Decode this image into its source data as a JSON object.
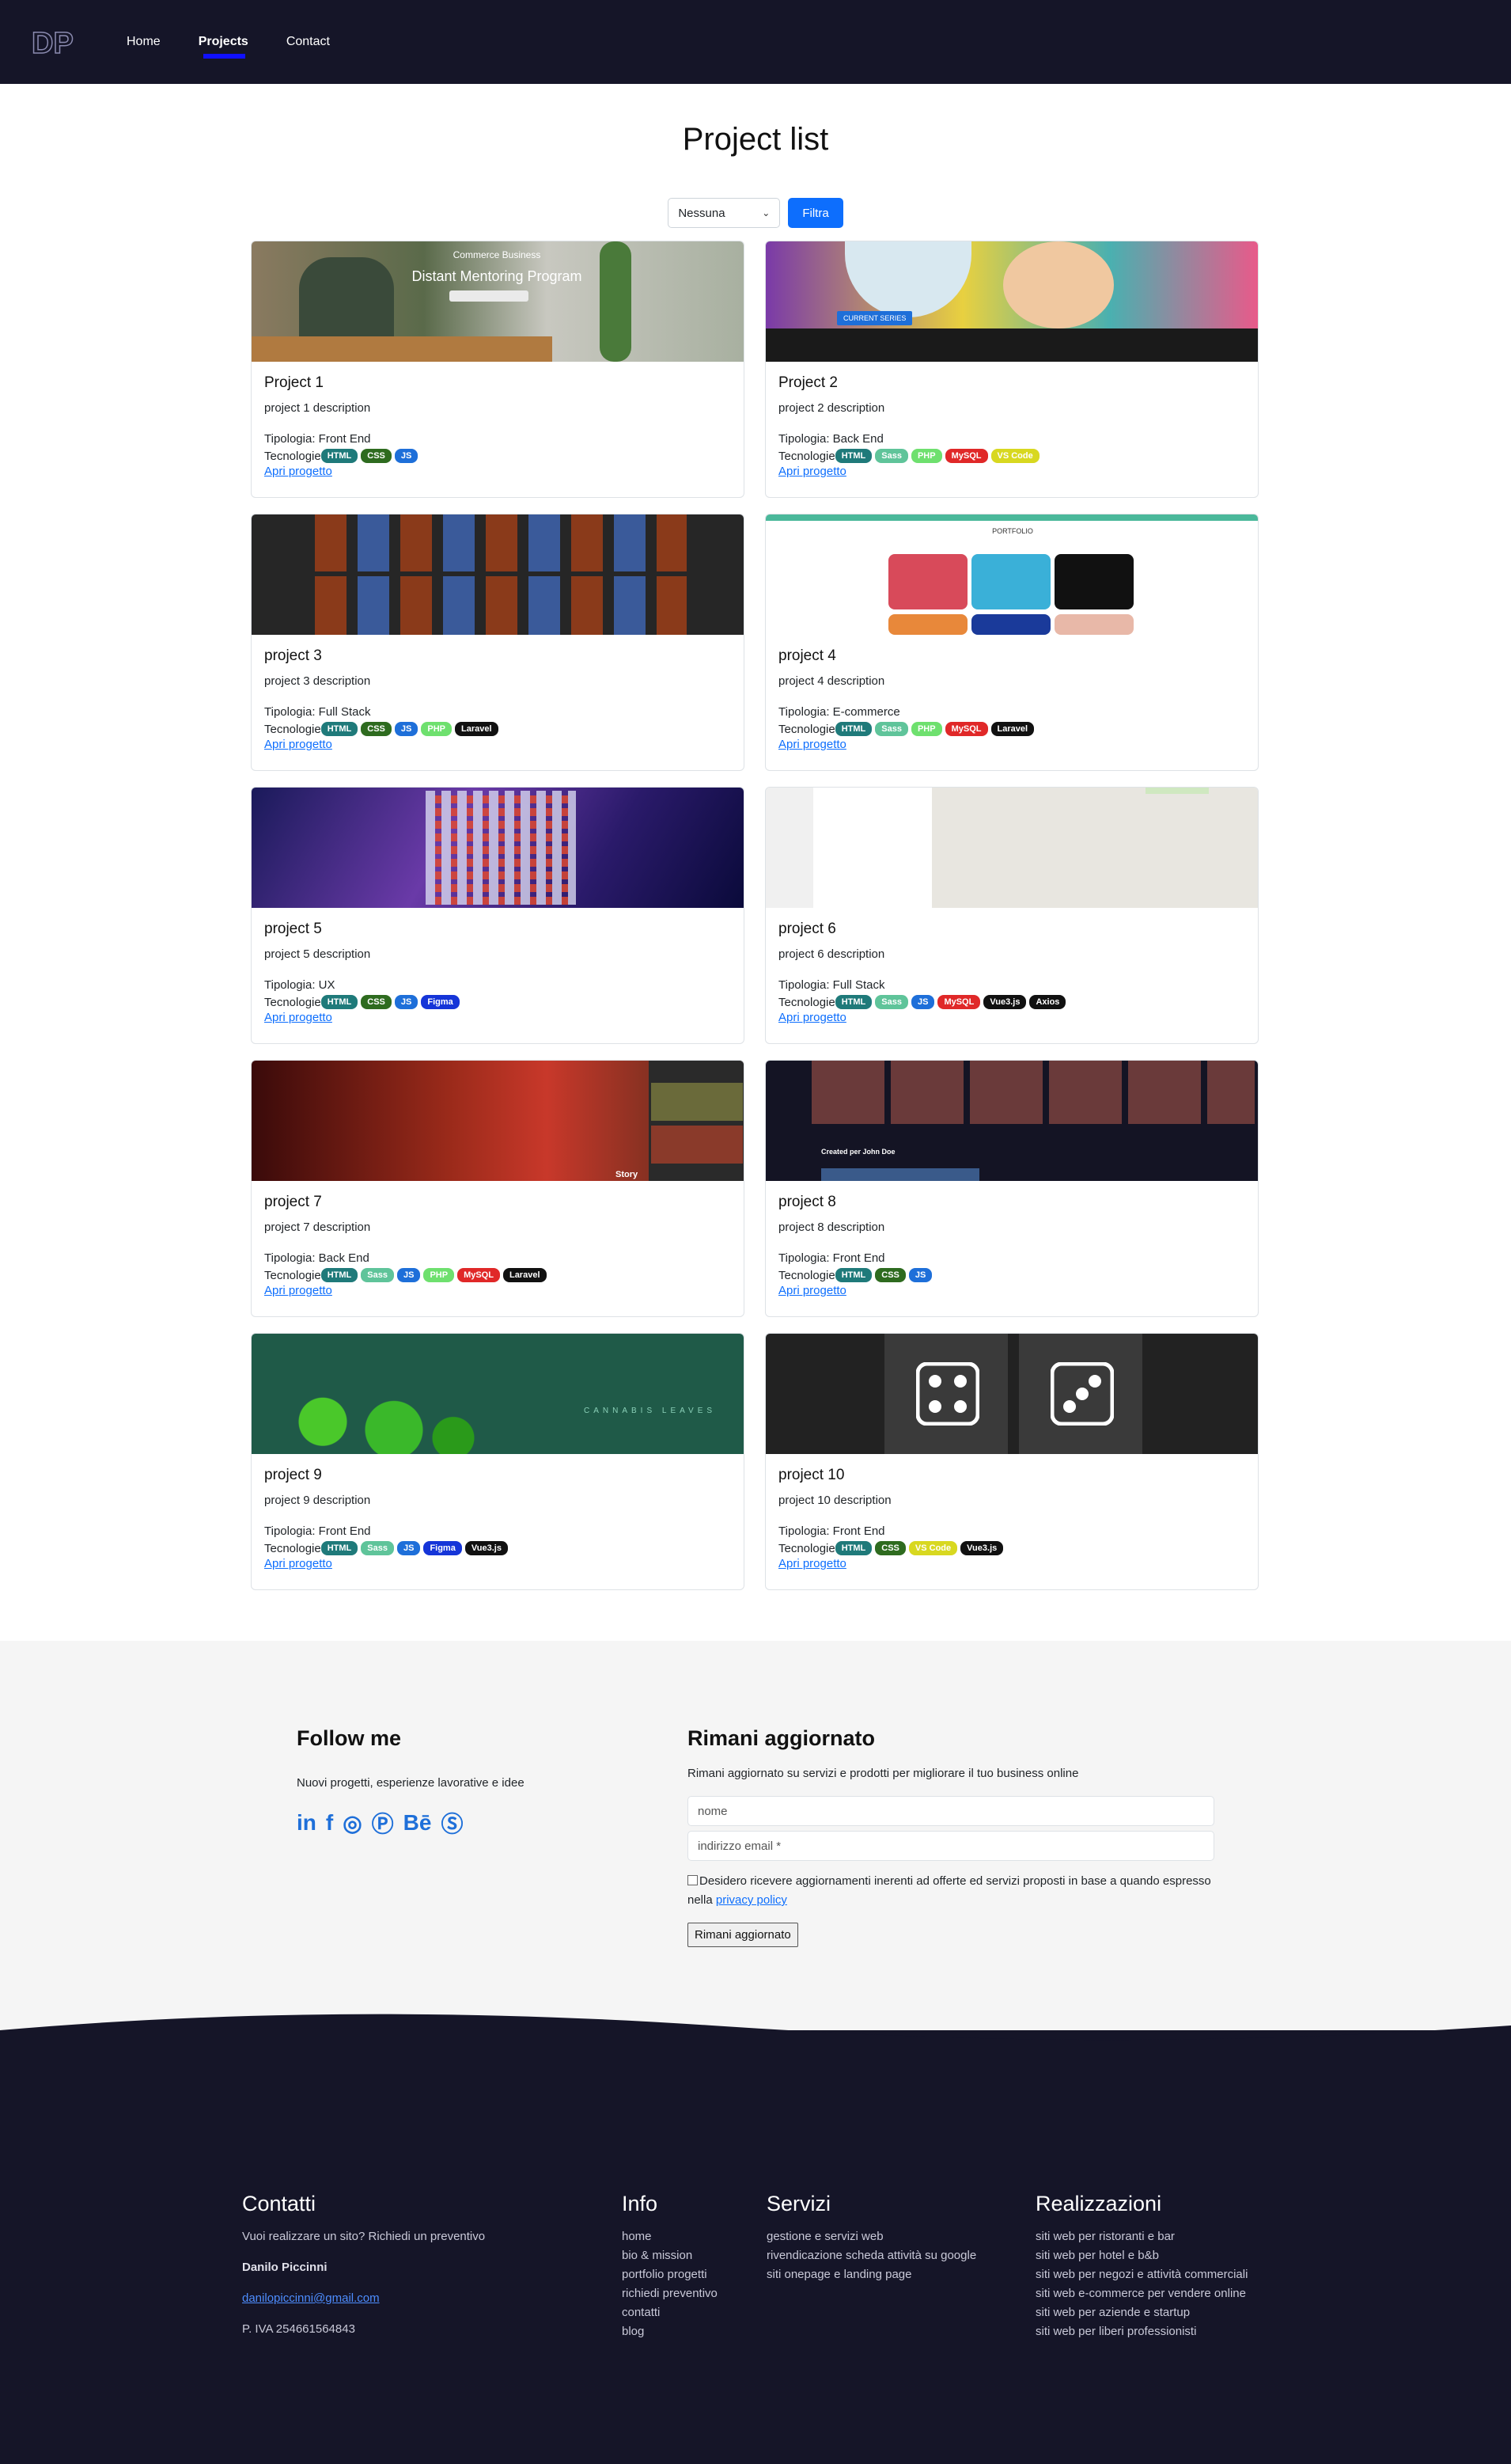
{
  "nav": {
    "logo_text": "DP",
    "links": [
      "Home",
      "Projects",
      "Contact"
    ]
  },
  "page_title": "Project list",
  "filter": {
    "selected": "Nessuna",
    "button": "Filtra"
  },
  "labels": {
    "type_prefix": "Tipologia: ",
    "tech_prefix": "Tecnologie",
    "open_link": "Apri progetto"
  },
  "image_texts": {
    "p1_title": "Commerce Business",
    "p1_heading": "Distant Mentoring Program",
    "p2_badge": "CURRENT SERIES",
    "p4_title": "PORTFOLIO",
    "p7_text": "Story",
    "p8_text": "Created per John Doe",
    "p9_title": "CANNABIS LEAVES"
  },
  "projects": [
    {
      "title": "Project 1",
      "description": "project 1 description",
      "type": "Front End",
      "techs": [
        "HTML",
        "CSS",
        "JS"
      ]
    },
    {
      "title": "Project 2",
      "description": "project 2 description",
      "type": "Back End",
      "techs": [
        "HTML",
        "Sass",
        "PHP",
        "MySQL",
        "VS Code"
      ]
    },
    {
      "title": "project 3",
      "description": "project 3 description",
      "type": "Full Stack",
      "techs": [
        "HTML",
        "CSS",
        "JS",
        "PHP",
        "Laravel"
      ]
    },
    {
      "title": "project 4",
      "description": "project 4 description",
      "type": "E-commerce",
      "techs": [
        "HTML",
        "Sass",
        "PHP",
        "MySQL",
        "Laravel"
      ]
    },
    {
      "title": "project 5",
      "description": "project 5 description",
      "type": "UX",
      "techs": [
        "HTML",
        "CSS",
        "JS",
        "Figma"
      ]
    },
    {
      "title": "project 6",
      "description": "project 6 description",
      "type": "Full Stack",
      "techs": [
        "HTML",
        "Sass",
        "JS",
        "MySQL",
        "Vue3.js",
        "Axios"
      ]
    },
    {
      "title": "project 7",
      "description": "project 7 description",
      "type": "Back End",
      "techs": [
        "HTML",
        "Sass",
        "JS",
        "PHP",
        "MySQL",
        "Laravel"
      ]
    },
    {
      "title": "project 8",
      "description": "project 8 description",
      "type": "Front End",
      "techs": [
        "HTML",
        "CSS",
        "JS"
      ]
    },
    {
      "title": "project 9",
      "description": "project 9 description",
      "type": "Front End",
      "techs": [
        "HTML",
        "Sass",
        "JS",
        "Figma",
        "Vue3.js"
      ]
    },
    {
      "title": "project 10",
      "description": "project 10 description",
      "type": "Front End",
      "techs": [
        "HTML",
        "CSS",
        "VS Code",
        "Vue3.js"
      ]
    }
  ],
  "tech_colors": {
    "HTML": "#1f7a7a",
    "CSS": "#2e6b1f",
    "JS": "#1e6fd9",
    "Sass": "#5fc49a",
    "PHP": "#6ee06e",
    "MySQL": "#e02828",
    "VS Code": "#d8d820",
    "Laravel": "#111111",
    "Figma": "#1535d8",
    "Vue3.js": "#111111",
    "Axios": "#111111"
  },
  "newsletter": {
    "follow_title": "Follow me",
    "follow_text": "Nuovi progetti, esperienze lavorative e idee",
    "social_icons": [
      "linkedin-icon",
      "facebook-icon",
      "dribbble-icon",
      "pinterest-icon",
      "behance-icon",
      "skype-icon"
    ],
    "social_glyphs": [
      "in",
      "f",
      "◎",
      "Ⓟ",
      "Bē",
      "Ⓢ"
    ],
    "subscribe_title": "Rimani aggiornato",
    "subscribe_text": "Rimani aggiornato su servizi e prodotti per migliorare il tuo business online",
    "name_placeholder": "nome",
    "email_placeholder": "indirizzo email *",
    "consent_text": "Desidero ricevere aggiornamenti inerenti ad offerte ed servizi proposti in base a quando espresso nella",
    "privacy_link": "privacy policy",
    "button": "Rimani aggiornato"
  },
  "footer": {
    "contatti": {
      "title": "Contatti",
      "cta": "Vuoi realizzare un sito? Richiedi un preventivo",
      "name": "Danilo Piccinni",
      "email": "danilopiccinni@gmail.com",
      "vat": "P. IVA 254661564843"
    },
    "info": {
      "title": "Info",
      "items": [
        "home",
        "bio & mission",
        "portfolio progetti",
        "richiedi preventivo",
        "contatti",
        "blog"
      ]
    },
    "servizi": {
      "title": "Servizi",
      "items": [
        "gestione e servizi web",
        "rivendicazione scheda attività su google",
        "siti onepage e landing page"
      ]
    },
    "realizzazioni": {
      "title": "Realizzazioni",
      "items": [
        "siti web per ristoranti e bar",
        "siti web per hotel e b&b",
        "siti web per negozi e attività commerciali",
        "siti web e-commerce per vendere online",
        "siti web per aziende e startup",
        "siti web per liberi professionisti"
      ]
    }
  }
}
